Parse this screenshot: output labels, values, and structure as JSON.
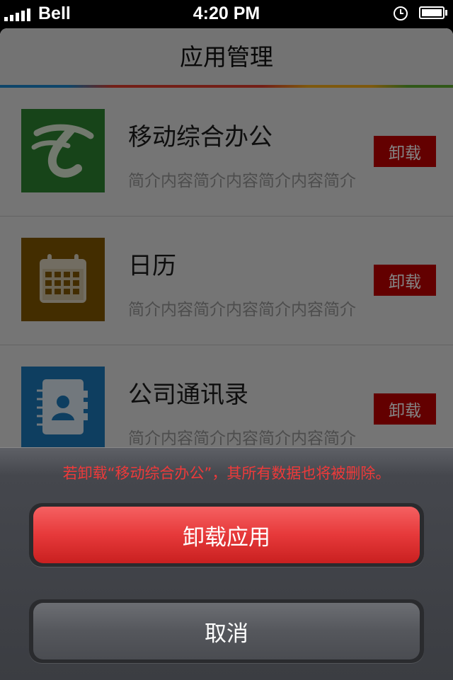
{
  "status_bar": {
    "carrier": "Bell",
    "time": "4:20 PM",
    "alarm_icon": "clock-icon",
    "battery_icon": "battery-icon"
  },
  "header": {
    "title": "应用管理"
  },
  "apps": [
    {
      "name": "移动综合办公",
      "description": "简介内容简介内容简介内容简介",
      "action_label": "卸载",
      "icon": "telecom-logo-icon",
      "icon_color": "#2a7d2e"
    },
    {
      "name": "日历",
      "description": "简介内容简介内容简介内容简介",
      "action_label": "卸载",
      "icon": "calendar-icon",
      "icon_color": "#7a5200"
    },
    {
      "name": "公司通讯录",
      "description": "简介内容简介内容简介内容简介",
      "action_label": "卸载",
      "icon": "address-book-icon",
      "icon_color": "#1a72b0"
    }
  ],
  "action_sheet": {
    "message": "若卸载“移动综合办公”，其所有数据也将被删除。",
    "confirm_label": "卸载应用",
    "cancel_label": "取消"
  },
  "colors": {
    "uninstall_red": "#b40000",
    "message_red": "#ee3a3a",
    "danger_button": "#e6393a"
  }
}
